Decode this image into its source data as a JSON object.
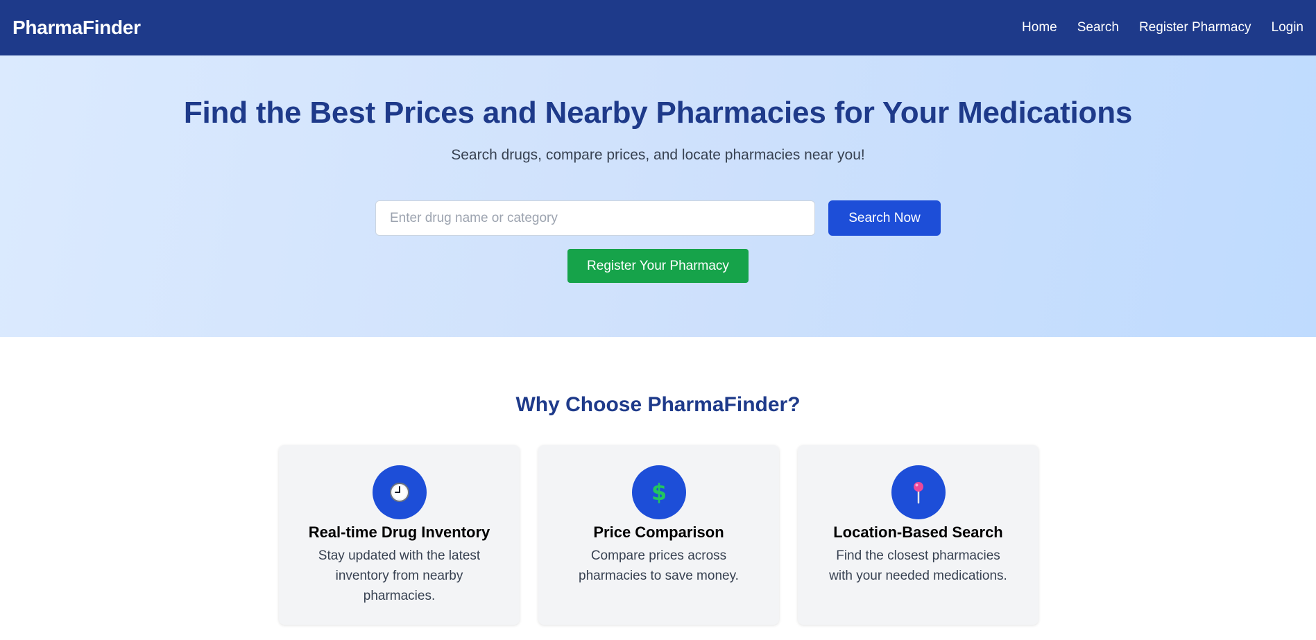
{
  "nav": {
    "brand": "PharmaFinder",
    "links": [
      "Home",
      "Search",
      "Register Pharmacy",
      "Login"
    ]
  },
  "hero": {
    "title": "Find the Best Prices and Nearby Pharmacies for Your Medications",
    "subtitle": "Search drugs, compare prices, and locate pharmacies near you!",
    "search_placeholder": "Enter drug name or category",
    "search_value": "",
    "search_button": "Search Now",
    "register_button": "Register Your Pharmacy"
  },
  "features": {
    "title": "Why Choose PharmaFinder?",
    "cards": [
      {
        "icon": "clock-icon",
        "title": "Real-time Drug Inventory",
        "desc": "Stay updated with the latest inventory from nearby pharmacies."
      },
      {
        "icon": "dollar-icon",
        "title": "Price Comparison",
        "desc": "Compare prices across pharmacies to save money."
      },
      {
        "icon": "pin-icon",
        "title": "Location-Based Search",
        "desc": "Find the closest pharmacies with your needed medications."
      }
    ]
  },
  "colors": {
    "nav_bg": "#1e3a8a",
    "primary": "#1d4ed8",
    "success": "#16a34a",
    "hero_bg": "#cfe1fc"
  }
}
